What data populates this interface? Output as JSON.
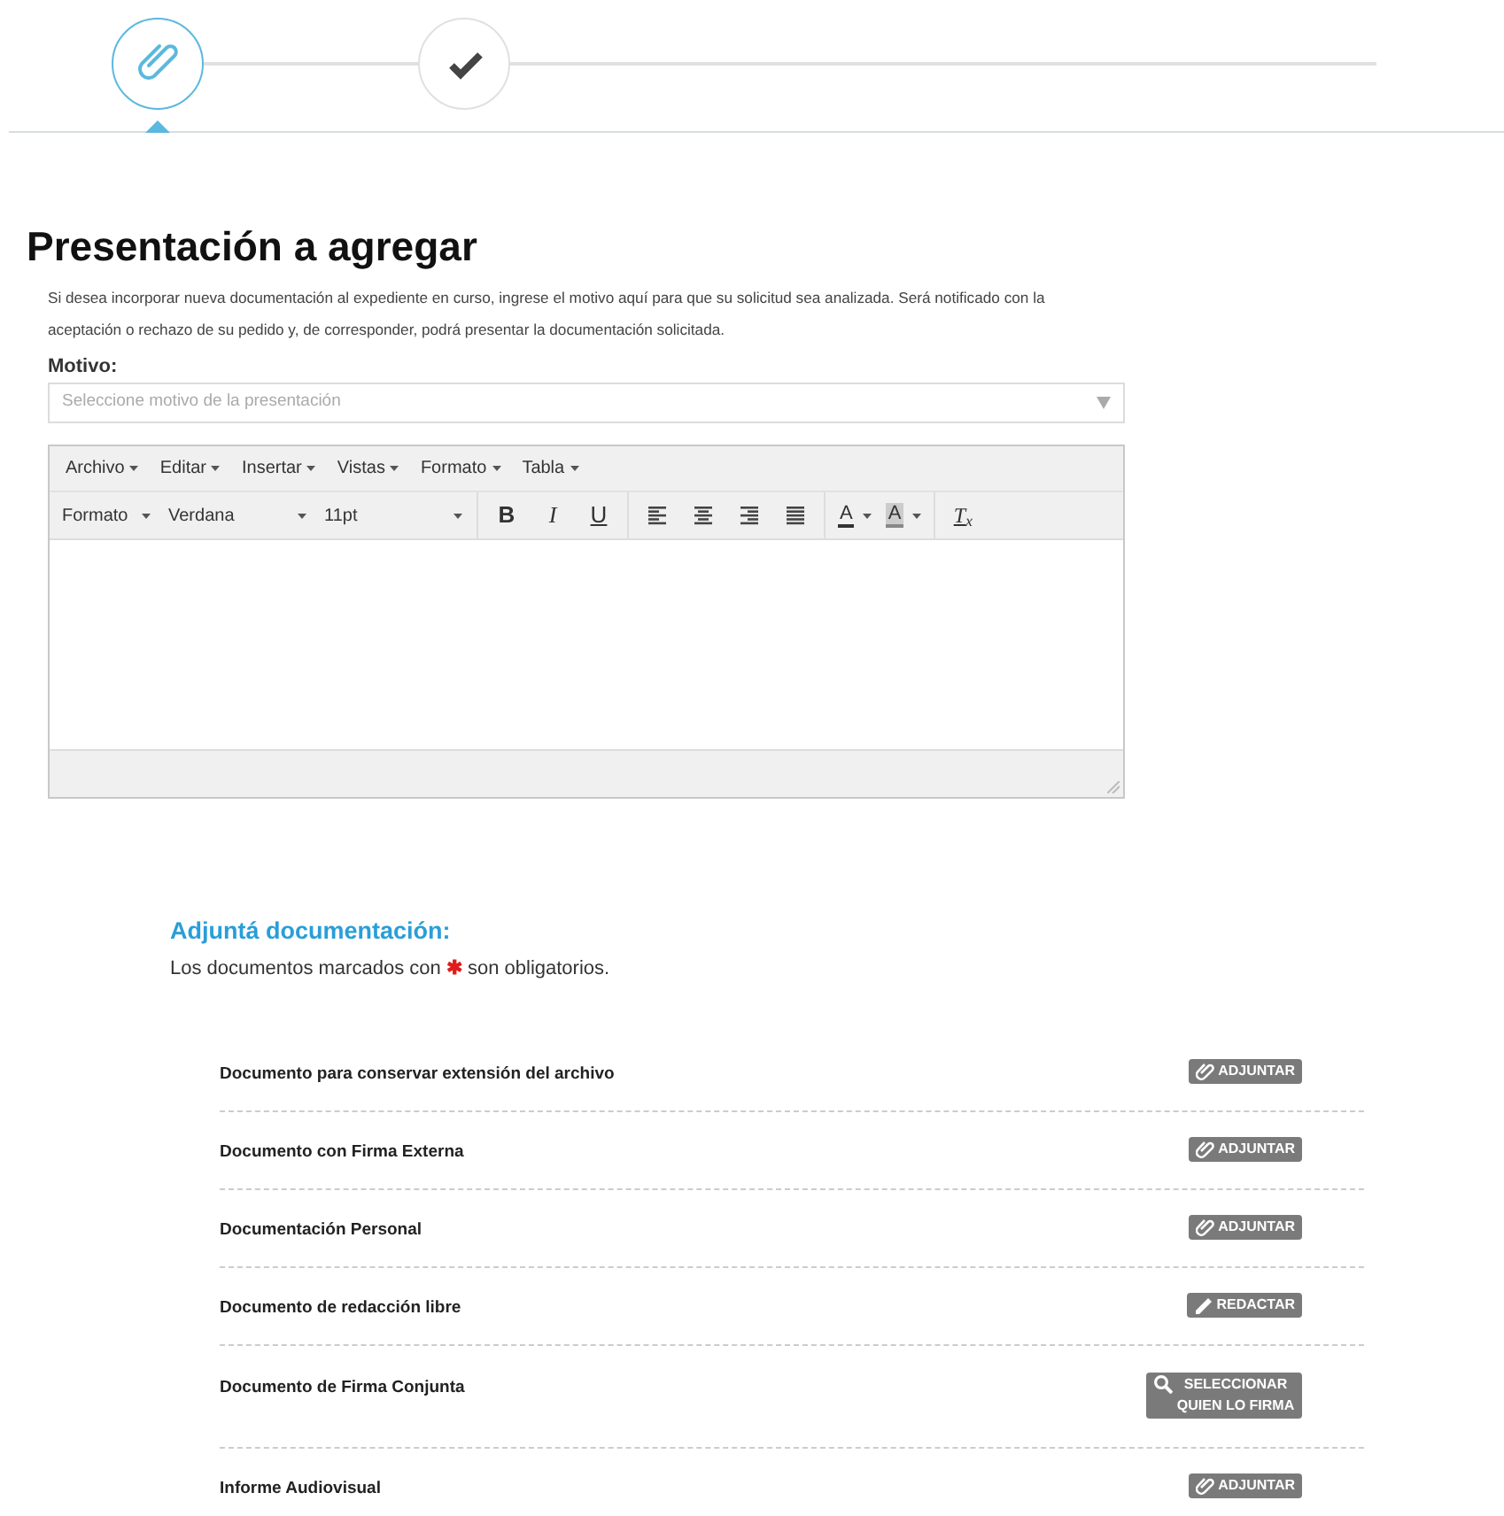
{
  "steps": [
    {
      "kind": "attach",
      "selected": true
    },
    {
      "kind": "check",
      "selected": false
    }
  ],
  "title": "Presentación a agregar",
  "description": "Si desea incorporar nueva documentación al expediente en curso, ingrese el motivo aquí para que su solicitud sea analizada. Será notificado con la aceptación o rechazo de su pedido y, de corresponder, podrá presentar la documentación solicitada.",
  "motivo": {
    "label": "Motivo:",
    "placeholder": "Seleccione motivo de la presentación"
  },
  "editor": {
    "menus": [
      "Archivo",
      "Editar",
      "Insertar",
      "Vistas",
      "Formato",
      "Tabla"
    ],
    "toolbar": [
      {
        "kind": "stylemenu",
        "label": "Formato"
      },
      {
        "kind": "dropdown",
        "label": "Verdana"
      },
      {
        "kind": "dropdown",
        "label": "11pt"
      },
      {
        "kind": "sep"
      },
      {
        "kind": "bold",
        "label": "B"
      },
      {
        "kind": "italic",
        "label": "I"
      },
      {
        "kind": "underline",
        "label": "U"
      },
      {
        "kind": "sep"
      },
      {
        "kind": "alignleft"
      },
      {
        "kind": "aligncenter"
      },
      {
        "kind": "alignright"
      },
      {
        "kind": "justify"
      },
      {
        "kind": "sep"
      },
      {
        "kind": "color",
        "label": "A"
      },
      {
        "kind": "highlight",
        "label": "A"
      },
      {
        "kind": "sep"
      },
      {
        "kind": "clear",
        "label": "T$_{x}$"
      }
    ]
  },
  "attachments": {
    "heading": "Adjuntá documentación:",
    "note": {
      "before": "Los documentos marcados con",
      "mark": "✱",
      "after": "son obligatorios."
    },
    "documents": [
      {
        "name": "Documento para conservar extensión del archivo",
        "action": {
          "kind": "attach",
          "label": "ADJUNTAR"
        }
      },
      {
        "name": "Documento con Firma Externa",
        "action": {
          "kind": "attach",
          "label": "ADJUNTAR"
        }
      },
      {
        "name": "Documentación Personal",
        "action": {
          "kind": "attach",
          "label": "ADJUNTAR"
        }
      },
      {
        "name": "Documento de redacción libre",
        "action": {
          "kind": "write",
          "label": "REDACTAR"
        }
      },
      {
        "name": "Documento de Firma Conjunta",
        "action": {
          "kind": "search",
          "label": "SELECCIONAR QUIEN LO FIRMA"
        }
      },
      {
        "name": "Informe Audiovisual",
        "action": {
          "kind": "attach",
          "label": "ADJUNTAR"
        }
      }
    ]
  }
}
